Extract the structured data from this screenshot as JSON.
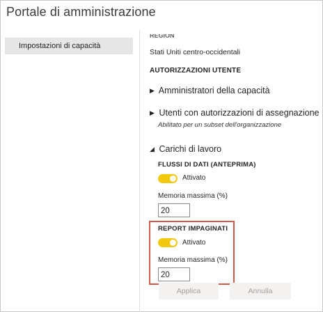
{
  "window": {
    "title": "Portale di amministrazione"
  },
  "sidebar": {
    "items": [
      {
        "label": "Impostazioni di capacità",
        "selected": true
      }
    ]
  },
  "main": {
    "region": {
      "label": "REGION",
      "value": "Stati Uniti centro-occidentali"
    },
    "user_permissions": {
      "heading": "AUTORIZZAZIONI UTENTE"
    },
    "capacity_admins": {
      "label": "Amministratori della capacità",
      "expanded": false
    },
    "assignment_permissions": {
      "label": "Utenti con autorizzazioni di assegnazione",
      "subtitle": "Abilitato per un subset dell'organizzazione",
      "expanded": false
    },
    "workloads": {
      "label": "Carichi di lavoro",
      "expanded": true,
      "dataflows": {
        "heading": "FLUSSI DI DATI (ANTEPRIMA)",
        "toggle_label": "Attivato",
        "toggle_on": true,
        "memory_label": "Memoria massima (%)",
        "memory_value": "20"
      },
      "paginated_reports": {
        "heading": "REPORT IMPAGINATI",
        "toggle_label": "Attivato",
        "toggle_on": true,
        "memory_label": "Memoria massima (%)",
        "memory_value": "20"
      }
    },
    "buttons": {
      "apply": "Applica",
      "cancel": "Annulla"
    }
  },
  "colors": {
    "toggle_on": "#f2c80f",
    "highlight_border": "#d65a4c",
    "sidebar_selected": "#e6e6e6"
  },
  "icons": {
    "collapsed": "triangle-right-icon",
    "expanded": "triangle-down-icon"
  }
}
